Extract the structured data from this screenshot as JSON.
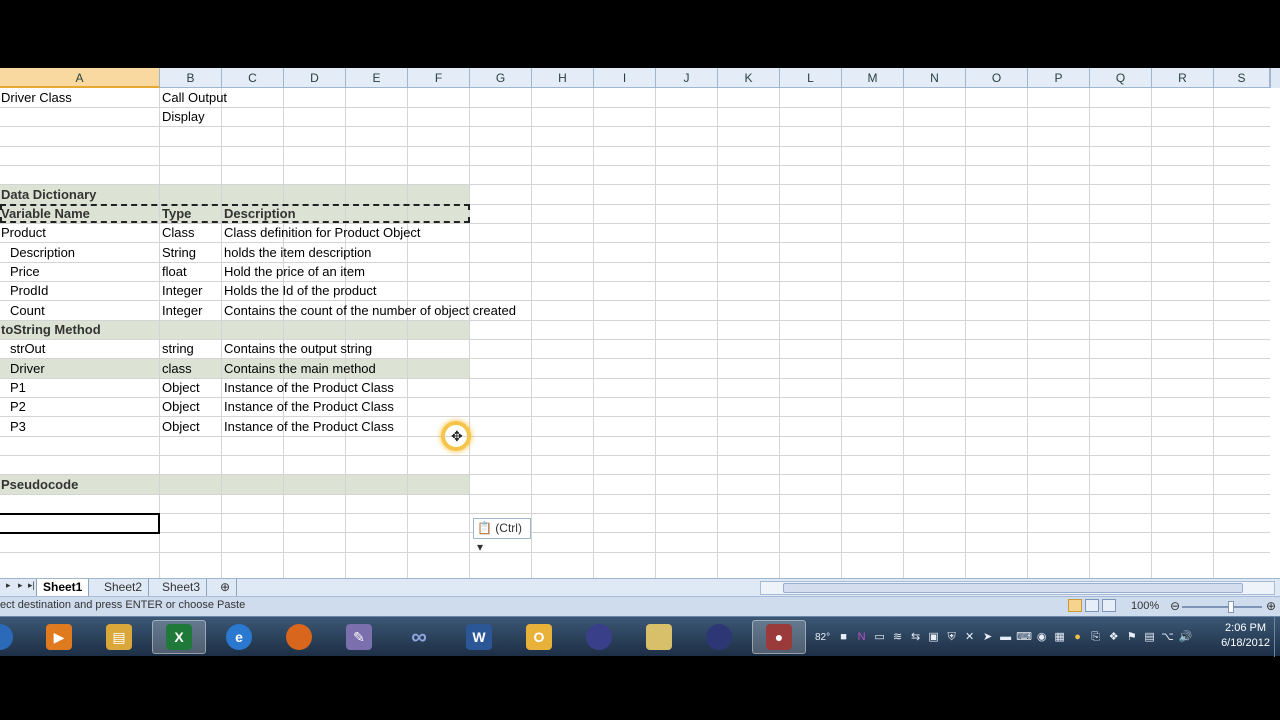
{
  "columns": [
    "A",
    "B",
    "C",
    "D",
    "E",
    "F",
    "G",
    "H",
    "I",
    "J",
    "K",
    "L",
    "M",
    "N",
    "O",
    "P",
    "Q",
    "R",
    "S"
  ],
  "active_column": "A",
  "rows": {
    "r1": {
      "a": "Driver Class",
      "b": "Call Output"
    },
    "r2": {
      "b": "Display"
    },
    "r5": {
      "a": "Data Dictionary"
    },
    "r6": {
      "a": "Variable Name",
      "b": "Type",
      "c": "Description"
    },
    "r7": {
      "a": "Product",
      "b": "Class",
      "c": "Class definition for Product Object"
    },
    "r8": {
      "a": "Description",
      "b": "String",
      "c": "holds the item description"
    },
    "r9": {
      "a": "Price",
      "b": "float",
      "c": "Hold the price of an item"
    },
    "r10": {
      "a": "ProdId",
      "b": "Integer",
      "c": "Holds the Id of the product"
    },
    "r11": {
      "a": "Count",
      "b": "Integer",
      "c": "Contains the count of the number of object created"
    },
    "r12": {
      "a": "toString Method"
    },
    "r13": {
      "a": "strOut",
      "b": "string",
      "c": "Contains the output string"
    },
    "r14": {
      "a": "Driver",
      "b": "class",
      "c": "Contains the main method"
    },
    "r15": {
      "a": "P1",
      "b": "Object",
      "c": "Instance of the Product Class"
    },
    "r16": {
      "a": "P2",
      "b": "Object",
      "c": "Instance of the Product Class"
    },
    "r17": {
      "a": "P3",
      "b": "Object",
      "c": "Instance of the Product Class"
    },
    "r20": {
      "a": "Pseudocode"
    }
  },
  "paste_options": {
    "label": "(Ctrl)",
    "icon": "clipboard-icon"
  },
  "sheet_tabs": [
    "Sheet1",
    "Sheet2",
    "Sheet3"
  ],
  "active_sheet": "Sheet1",
  "status": {
    "text": "ect destination and press ENTER or choose Paste",
    "zoom": "100%"
  },
  "taskbar": {
    "apps": [
      {
        "icon": "start-orb-icon",
        "color": "#2a6ab8"
      },
      {
        "icon": "media-player-icon",
        "color": "#e07a1f"
      },
      {
        "icon": "file-explorer-icon",
        "color": "#d9a73a"
      },
      {
        "icon": "excel-icon",
        "color": "#1f7a3a",
        "active": true
      },
      {
        "icon": "internet-explorer-icon",
        "color": "#2b78d1"
      },
      {
        "icon": "firefox-icon",
        "color": "#d8661c"
      },
      {
        "icon": "pen-tool-icon",
        "color": "#7c6fae"
      },
      {
        "icon": "infinity-icon",
        "color": "#5b74b8"
      },
      {
        "icon": "word-icon",
        "color": "#2b5797",
        "label": "W"
      },
      {
        "icon": "outlook-icon",
        "color": "#e8b23a"
      },
      {
        "icon": "eclipse-icon",
        "color": "#3a3f8a"
      },
      {
        "icon": "folder-icon",
        "color": "#d8c06a"
      },
      {
        "icon": "eclipse-alt-icon",
        "color": "#2d3775"
      },
      {
        "icon": "recorder-icon",
        "color": "#9a3a3a"
      }
    ],
    "tray_temp": "82°",
    "clock_time": "2:06 PM",
    "clock_date": "6/18/2012"
  },
  "colors": {
    "band": "#dde3d4",
    "header": "#e4ecf7",
    "active_header": "#f9d99f",
    "taskbar": "#2b4561"
  }
}
